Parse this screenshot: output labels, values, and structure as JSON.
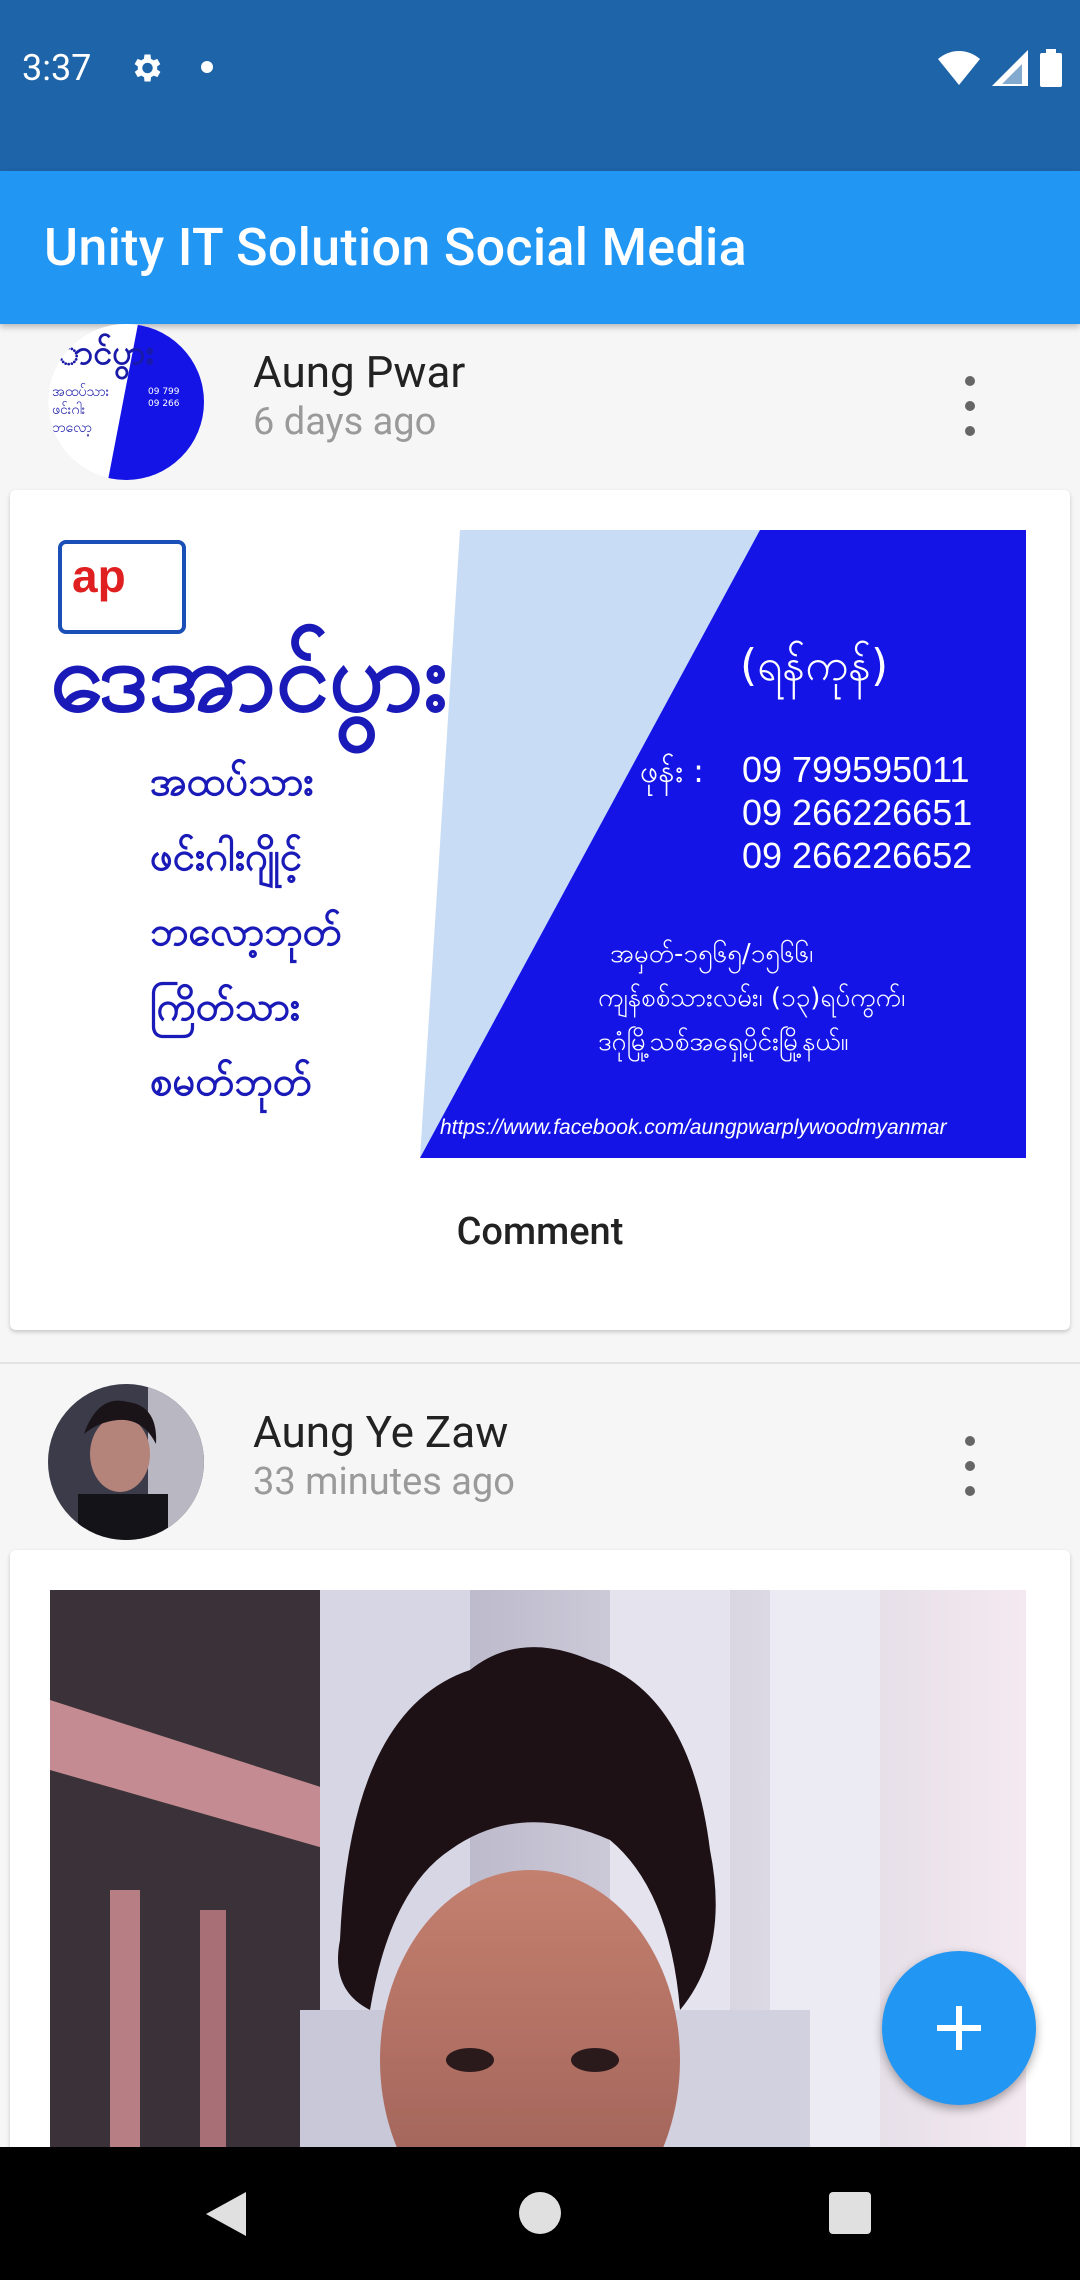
{
  "status_bar": {
    "time": "3:37"
  },
  "app_bar": {
    "title": "Unity IT Solution Social Media"
  },
  "posts": [
    {
      "author": "Aung Pwar",
      "time": "6 days ago",
      "image": {
        "brand": "ဒေအာင်ပွား",
        "logo_text": "ap",
        "city": "(ရန်ကုန်)",
        "phone_label": "ဖုန်း :",
        "phones": [
          "09 799595011",
          "09 266226651",
          "09 266226652"
        ],
        "products": [
          "အထပ်သား",
          "ဖင်းဂါးဂျိုင့်",
          "ဘလော့ဘုတ်",
          "ကြိတ်သား",
          "စမတ်ဘုတ်"
        ],
        "address": [
          "အမှတ်-၁၅၆၅/၁၅၆၆၊",
          "ကျန်စစ်သားလမ်း၊ (၁၃)ရပ်ကွက်၊",
          "ဒဂုံမြို့သစ်အရှေ့ပိုင်းမြို့နယ်။"
        ],
        "url": "https://www.facebook.com/aungpwarplywoodmyanmar"
      },
      "comment_label": "Comment"
    },
    {
      "author": "Aung Ye Zaw",
      "time": "33 minutes ago"
    }
  ],
  "colors": {
    "status_bar": "#1e64a8",
    "app_bar": "#2196f3",
    "fab": "#2196f3",
    "banner_blue": "#1414e6"
  },
  "icons": {
    "status": [
      "gear-icon",
      "wifi-icon",
      "signal-icon",
      "battery-icon"
    ],
    "post": [
      "more-vert-icon"
    ],
    "fab": "add-icon",
    "nav": [
      "back-icon",
      "home-icon",
      "recents-icon"
    ]
  }
}
